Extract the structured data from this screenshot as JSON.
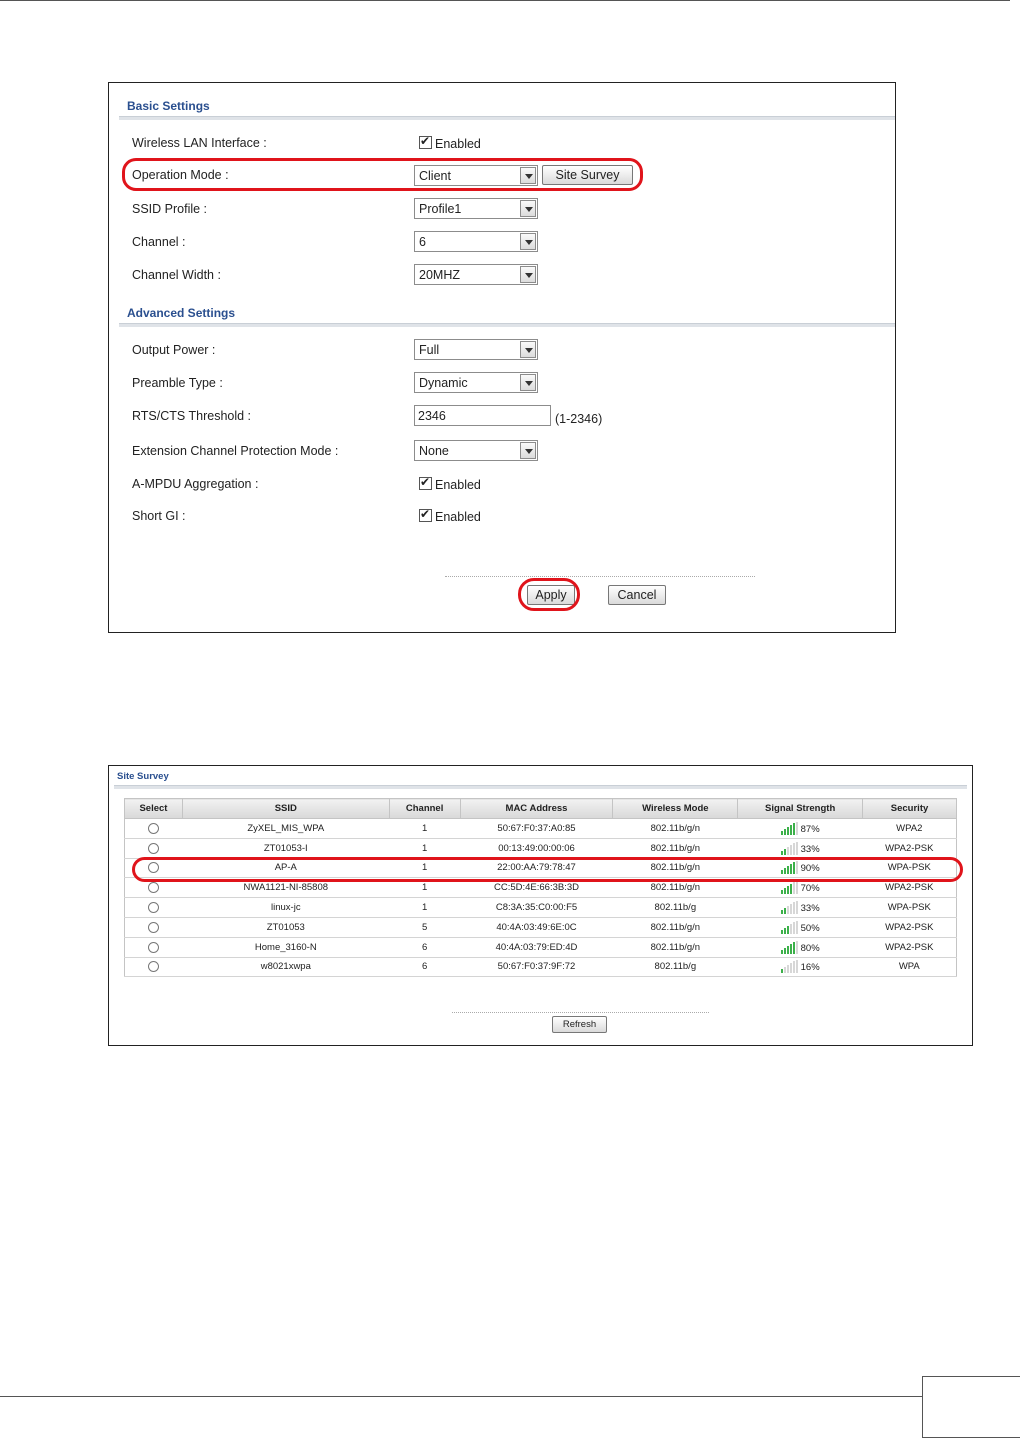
{
  "basic_settings": {
    "section_title": "Basic Settings",
    "wireless_lan_interface": {
      "label": "Wireless LAN Interface :",
      "checkbox_label": "Enabled",
      "checked": true
    },
    "operation_mode": {
      "label": "Operation Mode :",
      "value": "Client",
      "site_survey_button": "Site Survey"
    },
    "ssid_profile": {
      "label": "SSID Profile :",
      "value": "Profile1"
    },
    "channel": {
      "label": "Channel :",
      "value": "6"
    },
    "channel_width": {
      "label": "Channel Width :",
      "value": "20MHZ"
    }
  },
  "advanced_settings": {
    "section_title": "Advanced Settings",
    "output_power": {
      "label": "Output Power :",
      "value": "Full"
    },
    "preamble_type": {
      "label": "Preamble Type :",
      "value": "Dynamic"
    },
    "rts_cts_threshold": {
      "label": "RTS/CTS Threshold :",
      "value": "2346",
      "hint": "(1-2346)"
    },
    "extension_channel_protection": {
      "label": "Extension Channel Protection Mode :",
      "value": "None"
    },
    "ampdu_aggregation": {
      "label": "A-MPDU Aggregation :",
      "checkbox_label": "Enabled",
      "checked": true
    },
    "short_gi": {
      "label": "Short GI :",
      "checkbox_label": "Enabled",
      "checked": true
    }
  },
  "form_buttons": {
    "apply": "Apply",
    "cancel": "Cancel"
  },
  "site_survey": {
    "title": "Site Survey",
    "columns": [
      "Select",
      "SSID",
      "Channel",
      "MAC Address",
      "Wireless Mode",
      "Signal Strength",
      "Security"
    ],
    "rows": [
      {
        "ssid": "ZyXEL_MIS_WPA",
        "channel": "1",
        "mac": "50:67:F0:37:A0:85",
        "mode": "802.11b/g/n",
        "signal": "87%",
        "security": "WPA2"
      },
      {
        "ssid": "ZT01053-I",
        "channel": "1",
        "mac": "00:13:49:00:00:06",
        "mode": "802.11b/g/n",
        "signal": "33%",
        "security": "WPA2-PSK"
      },
      {
        "ssid": "AP-A",
        "channel": "1",
        "mac": "22:00:AA:79:78:47",
        "mode": "802.11b/g/n",
        "signal": "90%",
        "security": "WPA-PSK"
      },
      {
        "ssid": "NWA1121-NI-85808",
        "channel": "1",
        "mac": "CC:5D:4E:66:3B:3D",
        "mode": "802.11b/g/n",
        "signal": "70%",
        "security": "WPA2-PSK"
      },
      {
        "ssid": "linux-jc",
        "channel": "1",
        "mac": "C8:3A:35:C0:00:F5",
        "mode": "802.11b/g",
        "signal": "33%",
        "security": "WPA-PSK"
      },
      {
        "ssid": "ZT01053",
        "channel": "5",
        "mac": "40:4A:03:49:6E:0C",
        "mode": "802.11b/g/n",
        "signal": "50%",
        "security": "WPA2-PSK"
      },
      {
        "ssid": "Home_3160-N",
        "channel": "6",
        "mac": "40:4A:03:79:ED:4D",
        "mode": "802.11b/g/n",
        "signal": "80%",
        "security": "WPA2-PSK"
      },
      {
        "ssid": "w8021xwpa",
        "channel": "6",
        "mac": "50:67:F0:37:9F:72",
        "mode": "802.11b/g",
        "signal": "16%",
        "security": "WPA"
      }
    ],
    "refresh_button": "Refresh"
  },
  "colors": {
    "highlight": "#e0141b",
    "section_title": "#2a4f8f",
    "signal_on": "#3cb04a",
    "signal_off": "#d7d7d7"
  }
}
